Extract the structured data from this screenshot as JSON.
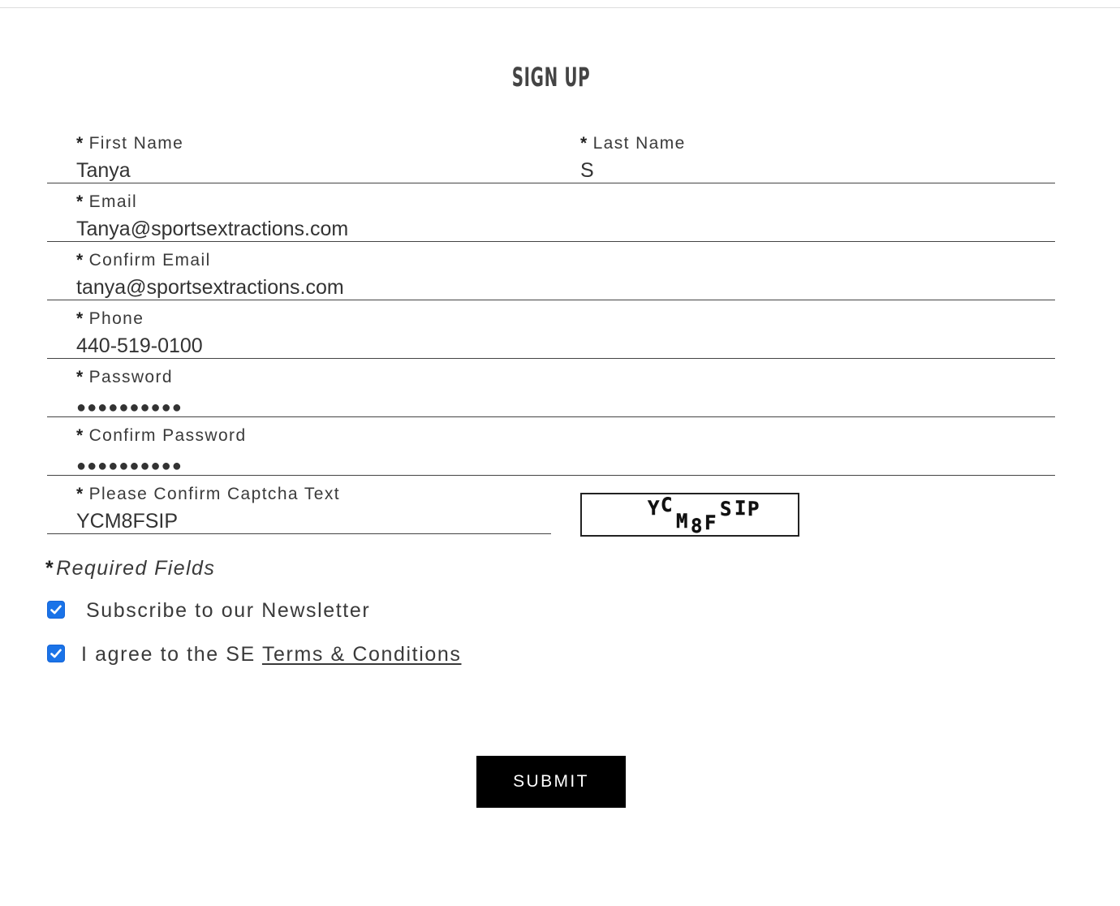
{
  "page": {
    "title": "SIGN UP"
  },
  "form": {
    "required_marker": "*",
    "fields": {
      "first_name": {
        "label": "First Name",
        "value": "Tanya"
      },
      "last_name": {
        "label": "Last Name",
        "value": "S"
      },
      "email": {
        "label": "Email",
        "value": "Tanya@sportsextractions.com"
      },
      "confirm_email": {
        "label": "Confirm Email",
        "value": "tanya@sportsextractions.com"
      },
      "phone": {
        "label": "Phone",
        "value": "440-519-0100"
      },
      "password": {
        "label": "Password",
        "value": "●●●●●●●●●●"
      },
      "confirm_password": {
        "label": "Confirm Password",
        "value": "●●●●●●●●●●"
      },
      "captcha": {
        "label": "Please Confirm Captcha Text",
        "value": "YCM8FSIP"
      }
    },
    "captcha_image": {
      "glyphs": [
        "Y",
        "C",
        "M",
        "8",
        "F",
        "S",
        "I",
        "P"
      ]
    },
    "required_note": "Required Fields",
    "newsletter": {
      "label": "Subscribe to our Newsletter",
      "checked": true
    },
    "terms": {
      "prefix": "I agree to the SE",
      "link_text": "Terms & Conditions",
      "checked": true
    },
    "submit_label": "SUBMIT"
  },
  "colors": {
    "checkbox_accent": "#1a73e8",
    "button_background": "#000000",
    "button_text": "#ffffff",
    "text": "#333333"
  }
}
